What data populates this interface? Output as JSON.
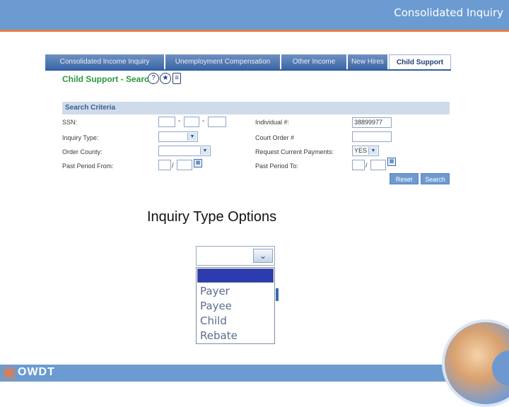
{
  "slide": {
    "title": "Consolidated Inquiry",
    "subtitle": "Inquiry Type Options",
    "footer_logo": "OWDT"
  },
  "tabs": [
    {
      "label": "Consolidated Income Inquiry",
      "active": false
    },
    {
      "label": "Unemployment Compensation",
      "active": false
    },
    {
      "label": "Other Income",
      "active": false
    },
    {
      "label": "New Hires",
      "active": false
    },
    {
      "label": "Child Support",
      "active": true
    }
  ],
  "search": {
    "title": "Child Support - Search",
    "icons": [
      "help-icon",
      "star-icon",
      "print-icon"
    ],
    "criteria_label": "Search Criteria",
    "fields": {
      "ssn_label": "SSN:",
      "inquiry_type_label": "Inquiry Type:",
      "order_county_label": "Order County:",
      "past_period_from_label": "Past Period From:",
      "individual_label": "Individual #:",
      "individual_value": "38899977",
      "court_order_label": "Court Order #",
      "request_payments_label": "Request Current Payments:",
      "request_payments_value": "YES",
      "past_period_to_label": "Past Period To:",
      "slash": "/",
      "dash": "-"
    },
    "buttons": {
      "reset": "Reset",
      "search": "Search"
    }
  },
  "dropdown": {
    "selected": "",
    "options": [
      "Payer",
      "Payee",
      "Child",
      "Rebate"
    ]
  },
  "colors": {
    "header_blue": "#6b9bd1",
    "accent_orange": "#e87a45",
    "title_green": "#2a9a3c",
    "selected_blue": "#2d3bb0"
  }
}
